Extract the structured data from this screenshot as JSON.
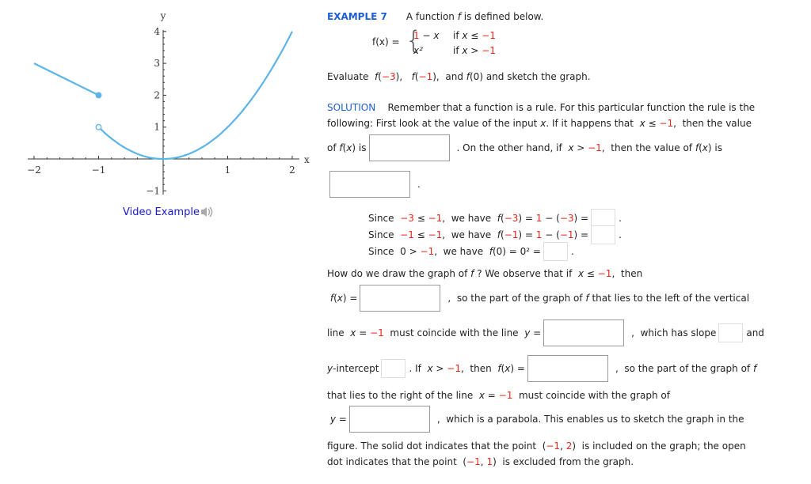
{
  "header": {
    "example_label": "EXAMPLE 7",
    "intro": [
      {
        "t": "A function "
      },
      {
        "t": "f",
        "s": "i"
      },
      {
        "t": " is defined below."
      }
    ]
  },
  "piecewise": {
    "lhs": "f(x) =",
    "brace": "{",
    "rows": [
      {
        "expr": [
          {
            "t": "1",
            "s": "r"
          },
          {
            "t": " − "
          },
          {
            "t": "x",
            "s": "i"
          }
        ],
        "cond": [
          {
            "t": "if "
          },
          {
            "t": "x",
            "s": "i"
          },
          {
            "t": " ≤ "
          },
          {
            "t": "−1",
            "s": "r"
          }
        ]
      },
      {
        "expr": [
          {
            "t": "x²",
            "s": "i"
          }
        ],
        "cond": [
          {
            "t": "if "
          },
          {
            "t": "x",
            "s": "i"
          },
          {
            "t": " > "
          },
          {
            "t": "−1",
            "s": "r"
          }
        ]
      }
    ]
  },
  "lines": [
    [
      {
        "t": "Evaluate  "
      },
      {
        "t": "f",
        "s": "i"
      },
      {
        "t": "("
      },
      {
        "t": "−3",
        "s": "r"
      },
      {
        "t": "),   "
      },
      {
        "t": "f",
        "s": "i"
      },
      {
        "t": "("
      },
      {
        "t": "−1",
        "s": "r"
      },
      {
        "t": "),  and "
      },
      {
        "t": "f",
        "s": "i"
      },
      {
        "t": "(0) and sketch the graph."
      }
    ],
    [
      {
        "t": "SOLUTION",
        "s": "blue"
      },
      {
        "t": "    Remember that a function is a rule. For this particular function the rule is the"
      }
    ],
    [
      {
        "t": "following: First look at the value of the input "
      },
      {
        "t": "x",
        "s": "i"
      },
      {
        "t": ". If it happens that  "
      },
      {
        "t": "x",
        "s": "i"
      },
      {
        "t": " ≤ "
      },
      {
        "t": "−1",
        "s": "r"
      },
      {
        "t": ",  then the value"
      }
    ],
    [
      {
        "t": "of "
      },
      {
        "t": "f",
        "s": "i"
      },
      {
        "t": "("
      },
      {
        "t": "x",
        "s": "i"
      },
      {
        "t": ") is"
      },
      {
        "input": "large"
      },
      {
        "t": ". On the other hand, if  "
      },
      {
        "t": "x",
        "s": "i"
      },
      {
        "t": " > "
      },
      {
        "t": "−1",
        "s": "r"
      },
      {
        "t": ",  then the value of "
      },
      {
        "t": "f",
        "s": "i"
      },
      {
        "t": "("
      },
      {
        "t": "x",
        "s": "i"
      },
      {
        "t": ") is"
      }
    ],
    [
      {
        "input": "large"
      },
      {
        "t": "."
      }
    ],
    [
      {
        "t": "Since  "
      },
      {
        "t": "−3",
        "s": "r"
      },
      {
        "t": " ≤ "
      },
      {
        "t": "−1",
        "s": "r"
      },
      {
        "t": ",  we have  "
      },
      {
        "t": "f",
        "s": "i"
      },
      {
        "t": "("
      },
      {
        "t": "−3",
        "s": "r"
      },
      {
        "t": ") = "
      },
      {
        "t": "1",
        "s": "r"
      },
      {
        "t": " − ("
      },
      {
        "t": "−3",
        "s": "r"
      },
      {
        "t": ") ="
      },
      {
        "input": "small"
      },
      {
        "t": "."
      }
    ],
    [
      {
        "t": "Since  "
      },
      {
        "t": "−1",
        "s": "r"
      },
      {
        "t": " ≤ "
      },
      {
        "t": "−1",
        "s": "r"
      },
      {
        "t": ",  we have  "
      },
      {
        "t": "f",
        "s": "i"
      },
      {
        "t": "("
      },
      {
        "t": "−1",
        "s": "r"
      },
      {
        "t": ") = "
      },
      {
        "t": "1",
        "s": "r"
      },
      {
        "t": " − ("
      },
      {
        "t": "−1",
        "s": "r"
      },
      {
        "t": ") ="
      },
      {
        "input": "small"
      },
      {
        "t": "."
      }
    ],
    [
      {
        "t": "Since  0 > "
      },
      {
        "t": "−1",
        "s": "r"
      },
      {
        "t": ",  we have  "
      },
      {
        "t": "f",
        "s": "i"
      },
      {
        "t": "(0) = 0² ="
      },
      {
        "input": "small"
      },
      {
        "t": "."
      }
    ],
    [
      {
        "t": "How do we draw the graph of "
      },
      {
        "t": "f",
        "s": "i"
      },
      {
        "t": " ? We observe that if  "
      },
      {
        "t": "x",
        "s": "i"
      },
      {
        "t": " ≤ "
      },
      {
        "t": "−1",
        "s": "r"
      },
      {
        "t": ",  then"
      }
    ],
    [
      {
        "t": " "
      },
      {
        "t": "f",
        "s": "i"
      },
      {
        "t": "("
      },
      {
        "t": "x",
        "s": "i"
      },
      {
        "t": ") ="
      },
      {
        "input": "large"
      },
      {
        "t": ",  so the part of the graph of "
      },
      {
        "t": "f",
        "s": "i"
      },
      {
        "t": " that lies to the left of the vertical"
      }
    ],
    [
      {
        "t": "line  "
      },
      {
        "t": "x",
        "s": "i"
      },
      {
        "t": " = "
      },
      {
        "t": "−1",
        "s": "r"
      },
      {
        "t": "  must coincide with the line  "
      },
      {
        "t": "y",
        "s": "i"
      },
      {
        "t": " ="
      },
      {
        "input": "large"
      },
      {
        "t": ",  which has slope"
      },
      {
        "input": "small"
      },
      {
        "t": "and"
      }
    ],
    [
      {
        "t": "y",
        "s": "i"
      },
      {
        "t": "-intercept"
      },
      {
        "input": "small"
      },
      {
        "t": ". If  "
      },
      {
        "t": "x",
        "s": "i"
      },
      {
        "t": " > "
      },
      {
        "t": "−1",
        "s": "r"
      },
      {
        "t": ",  then  "
      },
      {
        "t": "f",
        "s": "i"
      },
      {
        "t": "("
      },
      {
        "t": "x",
        "s": "i"
      },
      {
        "t": ") ="
      },
      {
        "input": "large"
      },
      {
        "t": ",  so the part of the graph of "
      },
      {
        "t": "f",
        "s": "i"
      }
    ],
    [
      {
        "t": "that lies to the right of the line  "
      },
      {
        "t": "x",
        "s": "i"
      },
      {
        "t": " = "
      },
      {
        "t": "−1",
        "s": "r"
      },
      {
        "t": "  must coincide with the graph of"
      }
    ],
    [
      {
        "t": " "
      },
      {
        "t": "y",
        "s": "i"
      },
      {
        "t": " ="
      },
      {
        "input": "large"
      },
      {
        "t": ",  which is a parabola. This enables us to sketch the graph in the"
      }
    ],
    [
      {
        "t": "figure. The solid dot indicates that the point  ("
      },
      {
        "t": "−1",
        "s": "r"
      },
      {
        "t": ", "
      },
      {
        "t": "2",
        "s": "r"
      },
      {
        "t": ")  is included on the graph; the open"
      }
    ],
    [
      {
        "t": "dot indicates that the point  ("
      },
      {
        "t": "−1",
        "s": "r"
      },
      {
        "t": ", "
      },
      {
        "t": "1",
        "s": "r"
      },
      {
        "t": ")  is excluded from the graph."
      }
    ]
  ],
  "video": {
    "label": "Video Example",
    "icon": "speaker-icon"
  },
  "colors": {
    "accent": "#1f5fd6",
    "highlight": "#e8261c",
    "curve": "#5bb5e8",
    "link": "#1a1ad0"
  },
  "chart_data": {
    "type": "line",
    "xlabel": "x",
    "ylabel": "y",
    "xlim": [
      -2,
      2
    ],
    "ylim": [
      -1,
      4
    ],
    "xticks": [
      -2,
      -1,
      1,
      2
    ],
    "yticks": [
      -1,
      1,
      2,
      3,
      4
    ],
    "xtick_labels": [
      "−2",
      "−1",
      "1",
      "2"
    ],
    "ytick_labels": [
      "−1",
      "1",
      "2",
      "3",
      "4"
    ],
    "grid": false,
    "series": [
      {
        "expr": "1 - x",
        "domain": [
          -2,
          -1
        ],
        "points": [
          [
            -2,
            3
          ],
          [
            -1,
            2
          ]
        ]
      },
      {
        "expr": "x^2",
        "domain": [
          -1,
          2
        ],
        "points": [
          [
            -1,
            1
          ],
          [
            -0.5,
            0.25
          ],
          [
            0,
            0
          ],
          [
            0.5,
            0.25
          ],
          [
            1,
            1
          ],
          [
            1.5,
            2.25
          ],
          [
            2,
            4
          ]
        ]
      }
    ],
    "markers": [
      {
        "x": -1,
        "y": 2,
        "style": "solid"
      },
      {
        "x": -1,
        "y": 1,
        "style": "open"
      }
    ]
  }
}
